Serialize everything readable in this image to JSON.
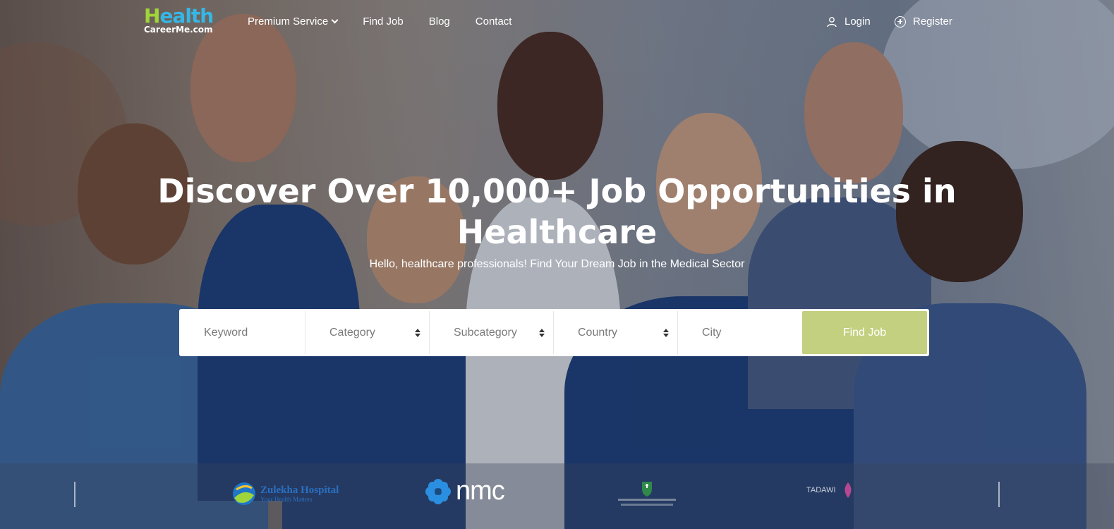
{
  "header": {
    "logo_main_first": "H",
    "logo_main_rest": "ealth",
    "logo_sub": "CareerMe.com",
    "nav": [
      {
        "label": "Premium Service",
        "has_dropdown": true
      },
      {
        "label": "Find Job"
      },
      {
        "label": "Blog"
      },
      {
        "label": "Contact"
      }
    ],
    "login_label": "Login",
    "register_label": "Register"
  },
  "hero": {
    "headline_line1": "Discover Over 10,000+ Job Opportunities in",
    "headline_line2": "Healthcare",
    "subheadline": "Hello, healthcare professionals! Find Your Dream Job in the Medical Sector"
  },
  "search": {
    "keyword_placeholder": "Keyword",
    "category_value": "Category",
    "subcategory_value": "Subcategory",
    "country_value": "Country",
    "city_placeholder": "City",
    "submit_label": "Find Job",
    "submit_color": "#c3d07f"
  },
  "partners": {
    "zulekha_name": "Zulekha Hospital",
    "zulekha_tag": "Your Health Matters",
    "nmc": "nmc",
    "tadawi": "TADAWI"
  },
  "colors": {
    "logo_blue": "#35b7e6",
    "logo_green": "#9fd53a"
  }
}
